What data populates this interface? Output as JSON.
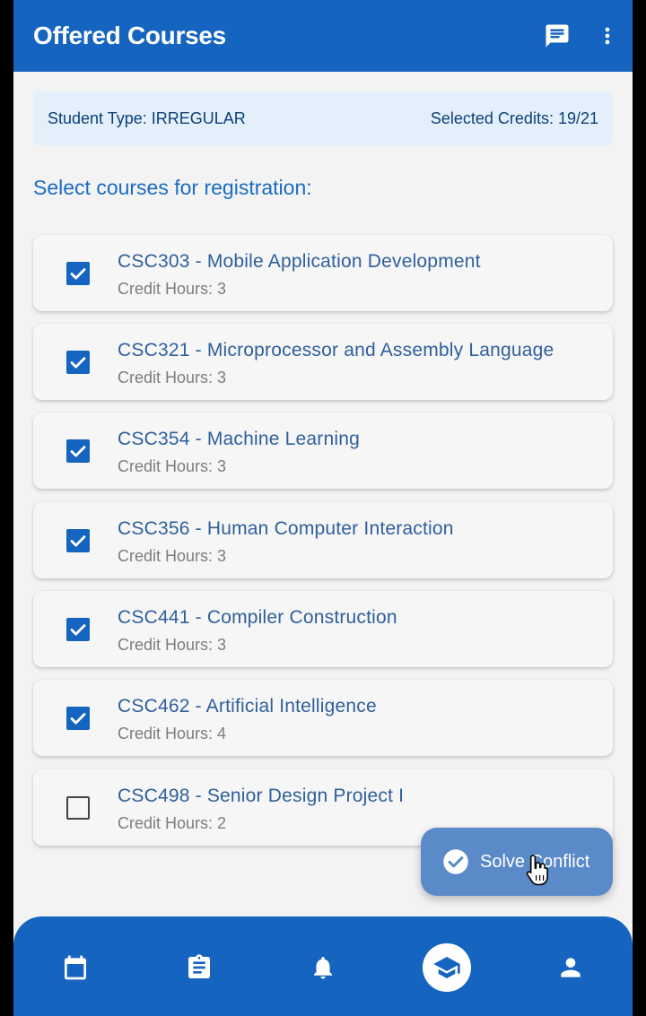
{
  "appbar": {
    "title": "Offered Courses",
    "icons": [
      "chat-icon",
      "more-vert-icon"
    ]
  },
  "info": {
    "student_type": "Student Type: IRREGULAR",
    "selected_credits": "Selected Credits: 19/21"
  },
  "section_title": "Select courses for registration:",
  "courses": [
    {
      "name": "CSC303 - Mobile Application Development",
      "credits": "Credit Hours: 3",
      "checked": true
    },
    {
      "name": "CSC321 - Microprocessor and Assembly Language",
      "credits": "Credit Hours: 3",
      "checked": true
    },
    {
      "name": "CSC354 - Machine Learning",
      "credits": "Credit Hours: 3",
      "checked": true
    },
    {
      "name": "CSC356 - Human Computer Interaction",
      "credits": "Credit Hours: 3",
      "checked": true
    },
    {
      "name": "CSC441 - Compiler Construction",
      "credits": "Credit Hours: 3",
      "checked": true
    },
    {
      "name": "CSC462 - Artificial Intelligence",
      "credits": "Credit Hours: 4",
      "checked": true
    },
    {
      "name": "CSC498 - Senior Design Project I",
      "credits": "Credit Hours: 2",
      "checked": false
    }
  ],
  "fab": {
    "label": "Solve Conflict",
    "icon": "check-circle-icon"
  },
  "bottom_nav": {
    "items": [
      {
        "icon": "calendar-icon",
        "active": false
      },
      {
        "icon": "clipboard-icon",
        "active": false
      },
      {
        "icon": "bell-icon",
        "active": false
      },
      {
        "icon": "graduation-cap-icon",
        "active": true
      },
      {
        "icon": "person-icon",
        "active": false
      }
    ]
  },
  "colors": {
    "primary": "#1565c0",
    "info_bg": "#e3f0fb",
    "fab": "#5b8ac8",
    "course_text": "#2f5f9c"
  }
}
